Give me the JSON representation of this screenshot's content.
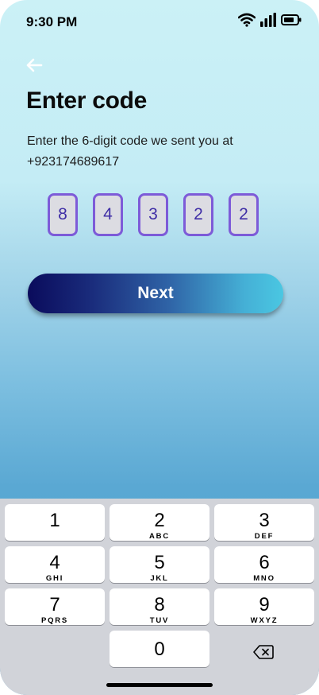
{
  "status_bar": {
    "time": "9:30 PM"
  },
  "screen": {
    "title": "Enter code",
    "subtitle": "Enter the 6-digit code we sent you at +923174689617"
  },
  "code": [
    "8",
    "4",
    "3",
    "2",
    "2"
  ],
  "next_label": "Next",
  "keyboard": {
    "keys": [
      {
        "num": "1",
        "letters": ""
      },
      {
        "num": "2",
        "letters": "ABC"
      },
      {
        "num": "3",
        "letters": "DEF"
      },
      {
        "num": "4",
        "letters": "GHI"
      },
      {
        "num": "5",
        "letters": "JKL"
      },
      {
        "num": "6",
        "letters": "MNO"
      },
      {
        "num": "7",
        "letters": "PQRS"
      },
      {
        "num": "8",
        "letters": "TUV"
      },
      {
        "num": "9",
        "letters": "WXYZ"
      },
      {
        "num": "0",
        "letters": ""
      }
    ]
  },
  "icons": {
    "back": "arrow-left-icon",
    "wifi": "wifi-icon",
    "signal": "cellular-signal-icon",
    "battery": "battery-icon",
    "delete": "backspace-icon"
  }
}
